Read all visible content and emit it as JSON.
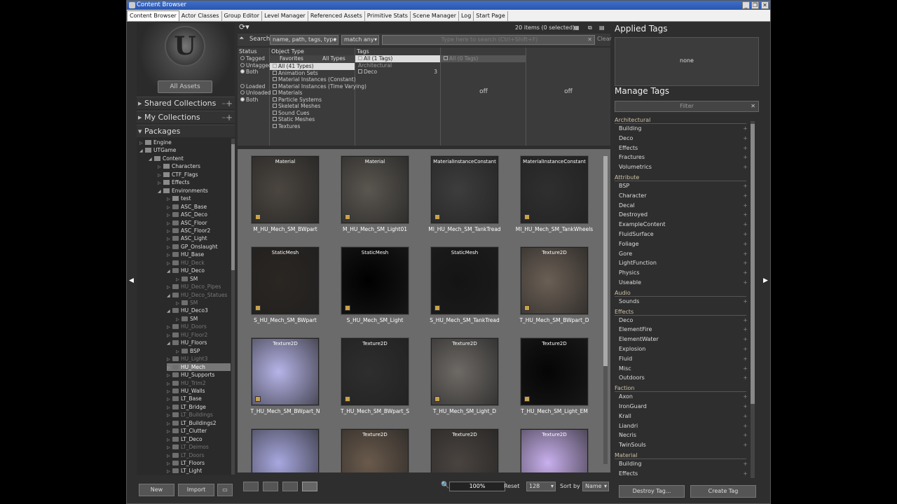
{
  "window": {
    "title": "Content Browser"
  },
  "tabs": [
    "Content Browser",
    "Actor Classes",
    "Group Editor",
    "Level Manager",
    "Referenced Assets",
    "Primitive Stats",
    "Scene Manager",
    "Log",
    "Start Page"
  ],
  "left": {
    "all_assets": "All Assets",
    "shared_collections": "Shared Collections",
    "my_collections": "My Collections",
    "packages": "Packages",
    "tree": [
      {
        "label": "Engine",
        "depth": 0,
        "arrow": "▷",
        "folder": true
      },
      {
        "label": "UTGame",
        "depth": 0,
        "arrow": "◢",
        "folder": true
      },
      {
        "label": "Content",
        "depth": 1,
        "arrow": "◢",
        "folder": true
      },
      {
        "label": "Characters",
        "depth": 2,
        "arrow": "▷",
        "folder": true
      },
      {
        "label": "CTF_Flags",
        "depth": 2,
        "arrow": "▷",
        "folder": true
      },
      {
        "label": "Effects",
        "depth": 2,
        "arrow": "▷",
        "folder": true
      },
      {
        "label": "Environments",
        "depth": 2,
        "arrow": "◢",
        "folder": true
      },
      {
        "label": "test",
        "depth": 3,
        "arrow": "▷",
        "folder": true
      },
      {
        "label": "ASC_Base",
        "depth": 3,
        "arrow": "▷"
      },
      {
        "label": "ASC_Deco",
        "depth": 3,
        "arrow": "▷"
      },
      {
        "label": "ASC_Floor",
        "depth": 3,
        "arrow": "▷"
      },
      {
        "label": "ASC_Floor2",
        "depth": 3,
        "arrow": "▷"
      },
      {
        "label": "ASC_Light",
        "depth": 3,
        "arrow": "▷"
      },
      {
        "label": "GP_Onslaught",
        "depth": 3,
        "arrow": "▷"
      },
      {
        "label": "HU_Base",
        "depth": 3,
        "arrow": "▷"
      },
      {
        "label": "HU_Deck",
        "depth": 3,
        "arrow": "▷",
        "dim": true
      },
      {
        "label": "HU_Deco",
        "depth": 3,
        "arrow": "◢"
      },
      {
        "label": "SM",
        "depth": 4,
        "arrow": "▷"
      },
      {
        "label": "HU_Deco_Pipes",
        "depth": 3,
        "arrow": "▷",
        "dim": true
      },
      {
        "label": "HU_Deco_Statues",
        "depth": 3,
        "arrow": "◢",
        "dim": true
      },
      {
        "label": "SM",
        "depth": 4,
        "arrow": "▷",
        "dim": true
      },
      {
        "label": "HU_Deco3",
        "depth": 3,
        "arrow": "◢"
      },
      {
        "label": "SM",
        "depth": 4,
        "arrow": "▷"
      },
      {
        "label": "HU_Doors",
        "depth": 3,
        "arrow": "▷",
        "dim": true
      },
      {
        "label": "HU_Floor2",
        "depth": 3,
        "arrow": "▷",
        "dim": true
      },
      {
        "label": "HU_Floors",
        "depth": 3,
        "arrow": "◢"
      },
      {
        "label": "BSP",
        "depth": 4,
        "arrow": "▷"
      },
      {
        "label": "HU_Light3",
        "depth": 3,
        "arrow": "▷",
        "dim": true
      },
      {
        "label": "HU_Mech",
        "depth": 3,
        "arrow": "▷",
        "sel": true
      },
      {
        "label": "HU_Supports",
        "depth": 3,
        "arrow": "▷"
      },
      {
        "label": "HU_Trim2",
        "depth": 3,
        "arrow": "▷",
        "dim": true
      },
      {
        "label": "HU_Walls",
        "depth": 3,
        "arrow": "▷"
      },
      {
        "label": "LT_Base",
        "depth": 3,
        "arrow": "▷"
      },
      {
        "label": "LT_Bridge",
        "depth": 3,
        "arrow": "▷"
      },
      {
        "label": "LT_Buildings",
        "depth": 3,
        "arrow": "▷",
        "dim": true
      },
      {
        "label": "LT_Buildings2",
        "depth": 3,
        "arrow": "▷"
      },
      {
        "label": "LT_Clutter",
        "depth": 3,
        "arrow": "▷"
      },
      {
        "label": "LT_Deco",
        "depth": 3,
        "arrow": "▷"
      },
      {
        "label": "LT_Deimos",
        "depth": 3,
        "arrow": "▷",
        "dim": true
      },
      {
        "label": "LT_Doors",
        "depth": 3,
        "arrow": "▷",
        "dim": true
      },
      {
        "label": "LT_Floors",
        "depth": 3,
        "arrow": "▷"
      },
      {
        "label": "LT_Light",
        "depth": 3,
        "arrow": "▷"
      }
    ],
    "new_button": "New",
    "import_button": "Import"
  },
  "search": {
    "label": "Search",
    "scope": "name, path, tags, type",
    "match": "match any",
    "placeholder": "Type here to search (Ctrl+Shift+F)",
    "clear": "Clear",
    "items_status": "20 items (0 selected)"
  },
  "filters": {
    "status_head": "Status",
    "status_items": [
      "Tagged",
      "Untagged",
      "Both",
      "Loaded",
      "Unloaded",
      "Both"
    ],
    "object_type_head": "Object Type",
    "favorites": "Favorites",
    "all_types": "All Types",
    "types": [
      "All (41 Types)",
      "Animation Sets",
      "Material Instances (Constant)",
      "Material Instances (Time Varying)",
      "Materials",
      "Particle Systems",
      "Skeletal Meshes",
      "Sound Cues",
      "Static Meshes",
      "Textures"
    ],
    "tags_head": "Tags",
    "tags_all": "All (1 Tags)",
    "tags_cat": "Architectural",
    "tags_deco": "Deco",
    "tags_deco_count": "3",
    "col4_all": "All (0 Tags)",
    "off1": "off",
    "off2": "off"
  },
  "assets": [
    {
      "type": "Material",
      "name": "M_HU_Mech_SM_BWpart",
      "color": "#4b4640"
    },
    {
      "type": "Material",
      "name": "M_HU_Mech_SM_Light01",
      "color": "#5a5650"
    },
    {
      "type": "MaterialInstanceConstant",
      "name": "MI_HU_Mech_SM_TankTread",
      "color": "#3d3d3d"
    },
    {
      "type": "MaterialInstanceConstant",
      "name": "MI_HU_Mech_SM_TankWheels",
      "color": "#2f2f2f"
    },
    {
      "type": "StaticMesh",
      "name": "S_HU_Mech_SM_BWpart",
      "color": "#2a2622"
    },
    {
      "type": "StaticMesh",
      "name": "S_HU_Mech_SM_Light",
      "color": "#000000"
    },
    {
      "type": "StaticMesh",
      "name": "S_HU_Mech_SM_TankTread",
      "color": "#141414"
    },
    {
      "type": "Texture2D",
      "name": "T_HU_Mech_SM_BWpart_D",
      "color": "#6b5f55"
    },
    {
      "type": "Texture2D",
      "name": "T_HU_Mech_SM_BWpart_N",
      "color": "#b6b4e8"
    },
    {
      "type": "Texture2D",
      "name": "T_HU_Mech_SM_BWpart_S",
      "color": "#2e2e2e"
    },
    {
      "type": "Texture2D",
      "name": "T_HU_Mech_SM_Light_D",
      "color": "#6e6a66"
    },
    {
      "type": "Texture2D",
      "name": "T_HU_Mech_SM_Light_EM",
      "color": "#050505"
    },
    {
      "type": "",
      "name": "",
      "color": "#a8a8e0"
    },
    {
      "type": "Texture2D",
      "name": "",
      "color": "#6a5a4c"
    },
    {
      "type": "Texture2D",
      "name": "",
      "color": "#4a4440"
    },
    {
      "type": "Texture2D",
      "name": "",
      "color": "#c9b0ee"
    }
  ],
  "bottom": {
    "zoom": "100%",
    "reset": "Reset",
    "size": "128",
    "sort_by": "Sort by",
    "sort_value": "Name"
  },
  "right": {
    "applied_tags": "Applied Tags",
    "applied_none": "none",
    "manage_tags": "Manage Tags",
    "filter_placeholder": "Filter",
    "categories": [
      {
        "name": "Architectural",
        "items": [
          "Building",
          "Deco",
          "Effects",
          "Fractures",
          "Volumetrics"
        ]
      },
      {
        "name": "Attribute",
        "items": [
          "BSP",
          "Character",
          "Decal",
          "Destroyed",
          "ExampleContent",
          "FluidSurface",
          "Foliage",
          "Gore",
          "LightFunction",
          "Physics",
          "Useable"
        ]
      },
      {
        "name": "Audio",
        "items": [
          "Sounds"
        ]
      },
      {
        "name": "Effects",
        "items": [
          "Deco",
          "ElementFire",
          "ElementWater",
          "Explosion",
          "Fluid",
          "Misc",
          "Outdoors"
        ]
      },
      {
        "name": "Faction",
        "items": [
          "Axon",
          "IronGuard",
          "Krall",
          "Liandri",
          "Necris",
          "TwinSouls"
        ]
      },
      {
        "name": "Material",
        "items": [
          "Building",
          "Effects"
        ]
      }
    ],
    "destroy_tag": "Destroy Tag...",
    "create_tag": "Create Tag"
  }
}
